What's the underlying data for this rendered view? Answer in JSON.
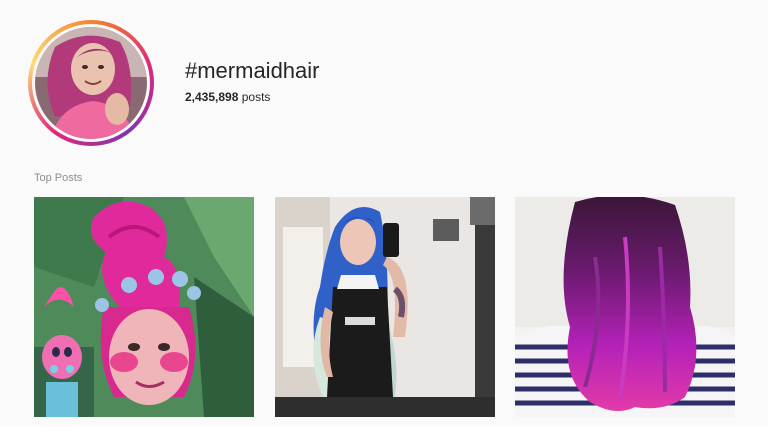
{
  "header": {
    "hashtag": "#mermaidhair",
    "post_count": "2,435,898",
    "post_count_suffix": "posts"
  },
  "top_posts": {
    "label": "Top Posts",
    "items": [
      {
        "subject": "girl with pink troll hair and Poppy troll doll"
      },
      {
        "subject": "mirror selfie with blue-to-white hair and black apron"
      },
      {
        "subject": "back of head with purple and magenta wavy hair"
      }
    ]
  },
  "colors": {
    "ring_gradient": [
      "#f58529",
      "#dd2a7b",
      "#8134af",
      "#feda77"
    ],
    "background": "#fafafa",
    "muted_text": "#8e8e8e"
  }
}
